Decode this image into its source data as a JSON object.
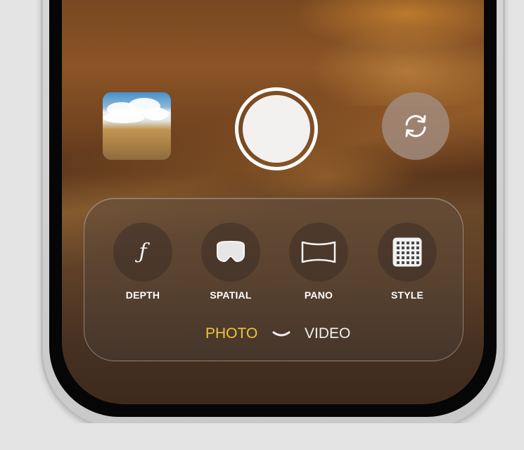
{
  "colors": {
    "page_background": "#e4e4e4",
    "mode_active": "#f0c53a",
    "mode_inactive": "#ececec",
    "label": "#ffffff",
    "flip_button_bg": "#a28c80"
  },
  "camera": {
    "last_photo_icon": "photo-thumbnail",
    "shutter_icon": "shutter-circle",
    "flip_icon": "rotate-arrows-icon"
  },
  "features": [
    {
      "label": "DEPTH",
      "icon": "f-stop-icon"
    },
    {
      "label": "SPATIAL",
      "icon": "headset-icon"
    },
    {
      "label": "PANO",
      "icon": "panorama-icon"
    },
    {
      "label": "STYLE",
      "icon": "grid-icon"
    }
  ],
  "modes": {
    "active": "PHOTO",
    "inactive": "VIDEO",
    "toggle_icon": "chevron-down-icon"
  }
}
